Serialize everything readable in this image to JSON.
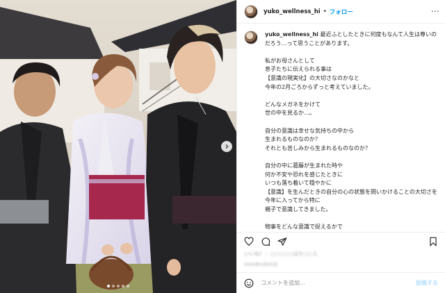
{
  "post": {
    "username": "yuko_wellness_hi",
    "separator": "•",
    "follow_label": "フォロー",
    "more_label": "···",
    "caption": "最近ふとしたときに何度もなんて人生は尊いのだろう…って思うことがあります。\n\n私がお母さんとして\n息子たちに伝えられる事は\n【意識の現実化】の大切さなのかなと\n今年の2月ごろからずっと考えていました。\n\nどんなメガネをかけて\n世の中を見るか…。\n\n自分の意識は幸せな気持ちの中から\n生まれるものなのか？\nそれとも苦しみから生まれるものなのか？\n\n自分の中に葛藤が生まれた時や\n何か不安や恐れを感じたときに\nいつも落ち着いて穏やかに\n【意識】を生んだときの自分の心の状態を問いかけることの大切さを\n今年に入ってから特に\n親子で意識してきました。\n\n物事をどんな意識で捉えるかで\n見える世界も",
    "likes_text": "いいね！：○○○○○ほか○○人",
    "date_text": "0000年0月00日",
    "comment_placeholder": "コメントを追加...",
    "post_button": "投稿する"
  },
  "icons": {
    "avatar": "avatar-image",
    "more": "more-options-icon",
    "next": "chevron-right-icon",
    "like": "heart-icon",
    "comment": "comment-bubble-icon",
    "share": "paper-plane-icon",
    "save": "bookmark-icon",
    "emoji": "smiley-icon"
  },
  "carousel": {
    "slide_count": 5,
    "active_index": 0
  },
  "colors": {
    "link": "#0095f6",
    "text": "#262626",
    "muted": "#8e8e8e",
    "divider": "#efefef"
  }
}
